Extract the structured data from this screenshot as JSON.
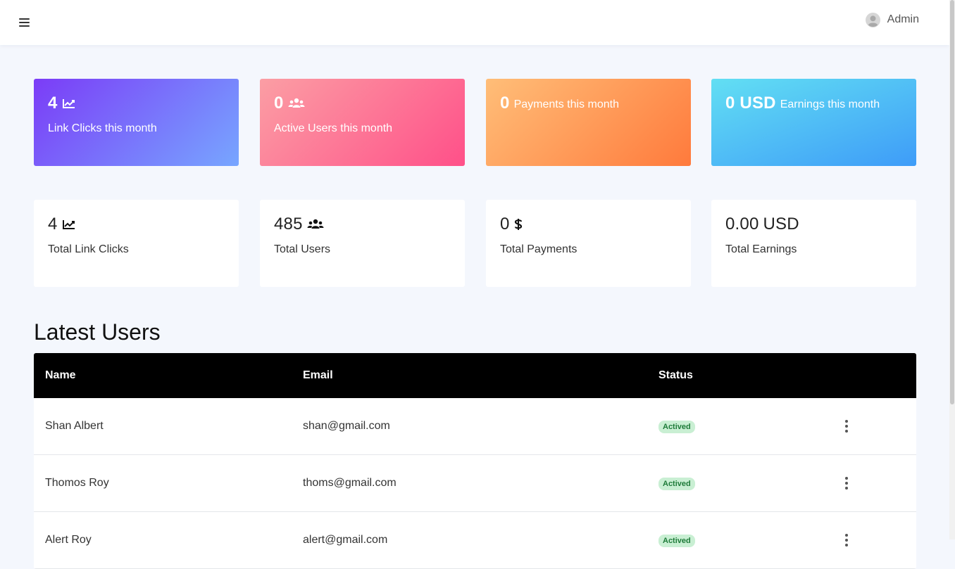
{
  "header": {
    "user_name": "Admin"
  },
  "month_cards": [
    {
      "value": "4",
      "label": "Link Clicks this month",
      "icon": "chart-line-icon",
      "gradient": [
        "#7b3cf7",
        "#77a6ff"
      ]
    },
    {
      "value": "0",
      "label": "Active Users this month",
      "icon": "users-icon",
      "gradient": [
        "#fb9ea4",
        "#ff5089"
      ]
    },
    {
      "value": "0",
      "label": "Payments this month",
      "icon": "",
      "gradient": [
        "#ffbe78",
        "#ff7a3c"
      ]
    },
    {
      "value": "0 USD",
      "label": "Earnings this month",
      "icon": "",
      "gradient": [
        "#62dff3",
        "#3e9cf8"
      ]
    }
  ],
  "total_cards": [
    {
      "value": "4",
      "label": "Total Link Clicks",
      "icon": "chart-line-icon"
    },
    {
      "value": "485",
      "label": "Total Users",
      "icon": "users-icon"
    },
    {
      "value": "0",
      "label": "Total Payments",
      "icon": "dollar-icon"
    },
    {
      "value_green": "0.00",
      "value_suffix": "USD",
      "label": "Total Earnings",
      "accent": "#28a745"
    }
  ],
  "latest_users": {
    "title": "Latest Users",
    "columns": [
      "Name",
      "Email",
      "Status"
    ],
    "rows": [
      {
        "name": "Shan Albert",
        "email": "shan@gmail.com",
        "status": "Actived"
      },
      {
        "name": "Thomos Roy",
        "email": "thoms@gmail.com",
        "status": "Actived"
      },
      {
        "name": "Alert Roy",
        "email": "alert@gmail.com",
        "status": "Actived"
      }
    ]
  }
}
